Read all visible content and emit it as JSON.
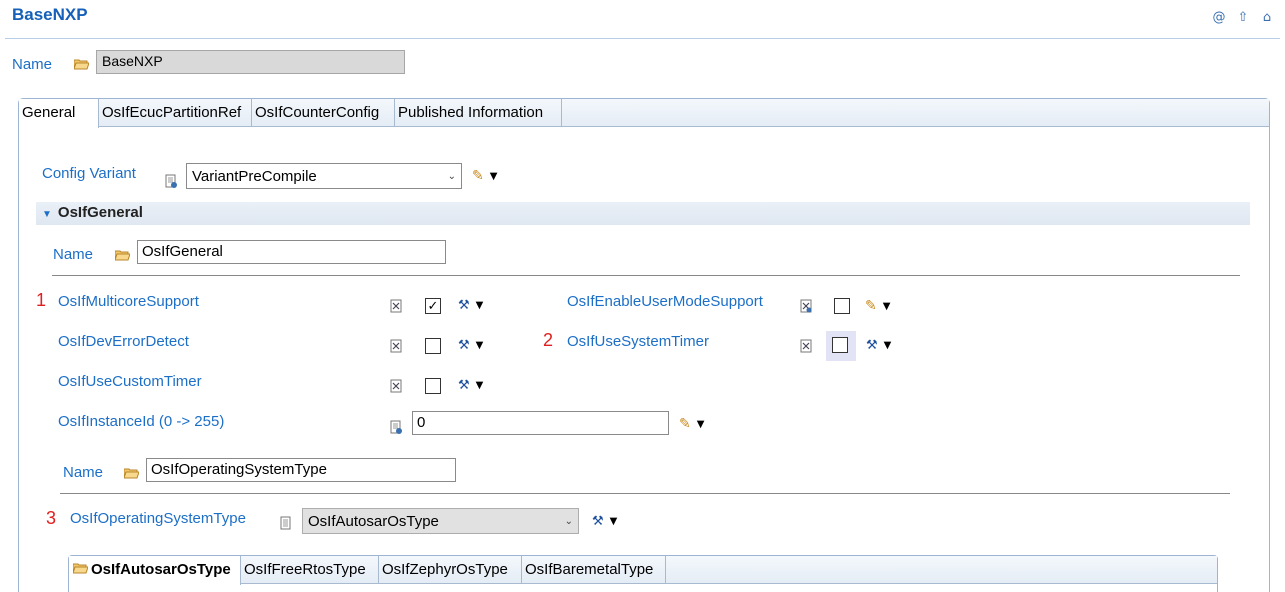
{
  "window": {
    "title": "BaseNXP"
  },
  "header_icons": [
    "at-icon",
    "up-arrow-icon",
    "home-icon"
  ],
  "name_field": {
    "label": "Name",
    "value": "BaseNXP"
  },
  "tabs": [
    "General",
    "OsIfEcucPartitionRef",
    "OsIfCounterConfig",
    "Published Information"
  ],
  "config_variant": {
    "label": "Config Variant",
    "value": "VariantPreCompile"
  },
  "section": {
    "title": "OsIfGeneral",
    "name_label": "Name",
    "name_value": "OsIfGeneral"
  },
  "params": {
    "multicore": {
      "label": "OsIfMulticoreSupport",
      "checked": true,
      "marker": "1"
    },
    "enable_user_mode": {
      "label": "OsIfEnableUserModeSupport",
      "checked": false
    },
    "dev_error": {
      "label": "OsIfDevErrorDetect",
      "checked": false
    },
    "use_system_timer": {
      "label": "OsIfUseSystemTimer",
      "checked": false,
      "marker": "2"
    },
    "custom_timer": {
      "label": "OsIfUseCustomTimer",
      "checked": false
    },
    "instance_id": {
      "label": "OsIfInstanceId (0 -> 255)",
      "value": "0"
    }
  },
  "os_type_container": {
    "name_label": "Name",
    "name_value": "OsIfOperatingSystemType",
    "select_label": "OsIfOperatingSystemType",
    "select_value": "OsIfAutosarOsType",
    "marker": "3"
  },
  "sub_tabs": [
    "OsIfAutosarOsType",
    "OsIfFreeRtosType",
    "OsIfZephyrOsType",
    "OsIfBaremetalType"
  ],
  "colors": {
    "label_blue": "#1c6fc7",
    "title_blue": "#1560b8",
    "marker_red": "#e02020"
  }
}
